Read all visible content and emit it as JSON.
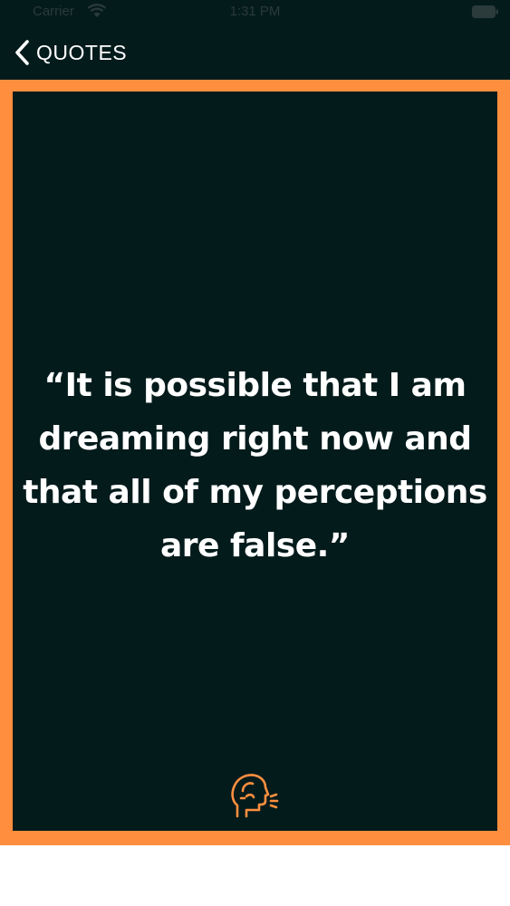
{
  "status_bar": {
    "carrier": "Carrier",
    "time": "1:31 PM",
    "wifi_icon": "wifi-icon",
    "battery_icon": "battery-icon"
  },
  "nav": {
    "back_icon": "chevron-left-icon",
    "back_label": "QUOTES"
  },
  "quote": {
    "text": "“It is possible that I am dreaming right now and that all of my perceptions are false.”",
    "icon": "speaking-head-icon"
  },
  "colors": {
    "background": "#041b1c",
    "accent": "#ff8f3f",
    "text": "#ffffff"
  }
}
